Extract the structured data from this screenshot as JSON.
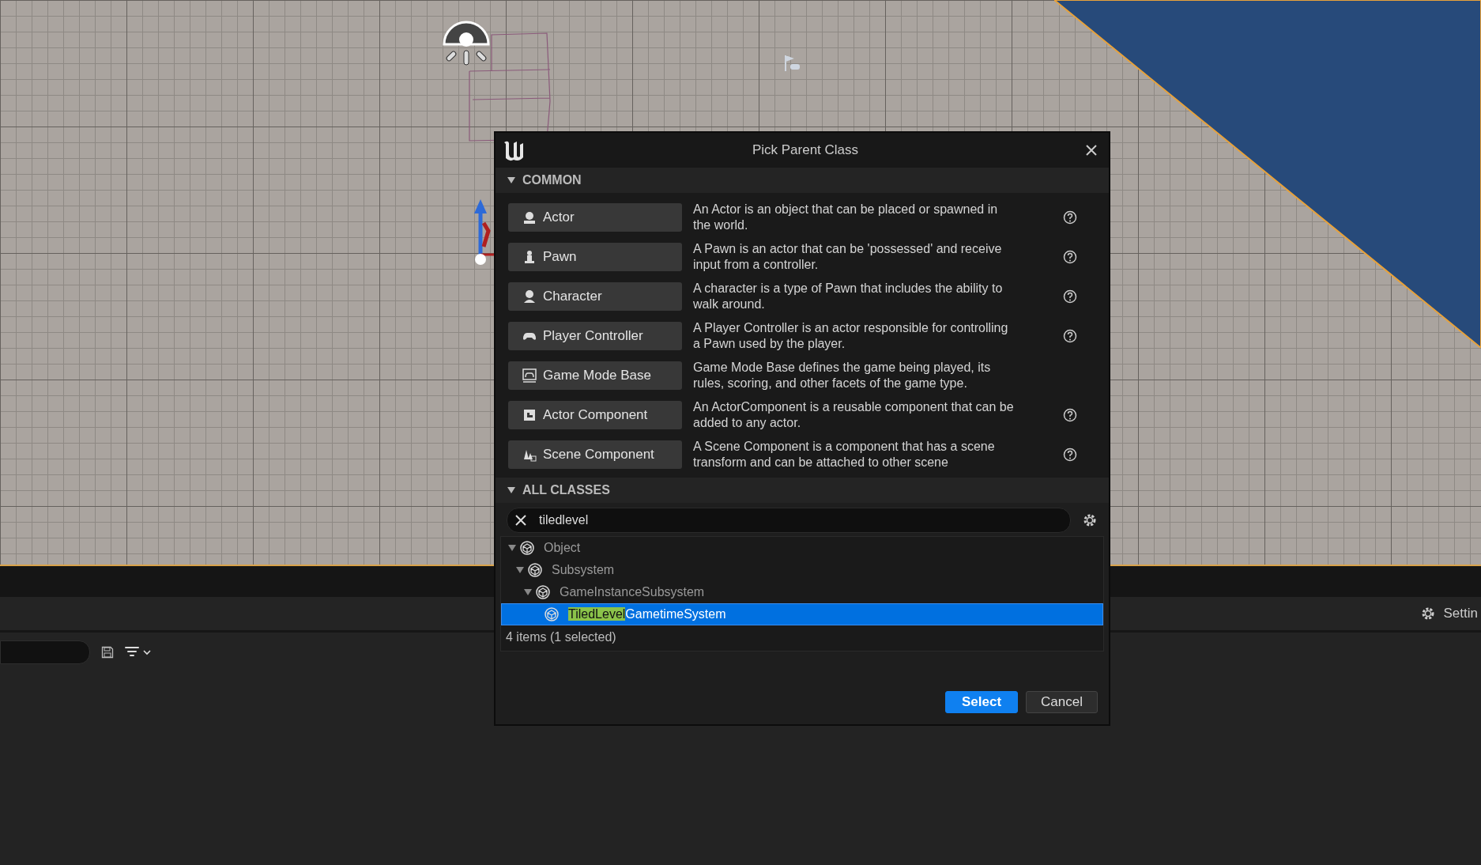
{
  "dialog": {
    "title": "Pick Parent Class",
    "common": {
      "label": "COMMON",
      "expanded": true,
      "items": [
        {
          "kind": "actor",
          "label": "Actor",
          "description": [
            "An Actor is an object that can be placed or spawned in",
            "the world."
          ],
          "help": true
        },
        {
          "kind": "pawn",
          "label": "Pawn",
          "description": [
            "A Pawn is an actor that can be 'possessed' and receive",
            "input from a controller."
          ],
          "help": true
        },
        {
          "kind": "character",
          "label": "Character",
          "description": [
            "A character is a type of Pawn that includes the ability to",
            "walk around."
          ],
          "help": true
        },
        {
          "kind": "controller",
          "label": "Player Controller",
          "description": [
            "A Player Controller is an actor responsible for controlling",
            "a Pawn used by the player."
          ],
          "help": true
        },
        {
          "kind": "gamemode",
          "label": "Game Mode Base",
          "description": [
            "Game Mode Base defines the game being played, its",
            "rules, scoring, and other facets of the game type."
          ],
          "help": false
        },
        {
          "kind": "component",
          "label": "Actor Component",
          "description": [
            "An ActorComponent is a reusable component that can be",
            "added to any actor."
          ],
          "help": true
        },
        {
          "kind": "scene",
          "label": "Scene Component",
          "description": [
            "A Scene Component is a component that has a scene",
            "transform and can be attached to other scene"
          ],
          "help": true
        }
      ]
    },
    "all_classes": {
      "label": "ALL CLASSES",
      "expanded": true,
      "search": {
        "value": "tiledlevel"
      },
      "tree": [
        {
          "name": {
            "rest": "Object"
          },
          "expanded": true,
          "selected": false,
          "children": [
            {
              "name": {
                "rest": "Subsystem"
              },
              "expanded": true,
              "selected": false,
              "children": [
                {
                  "name": {
                    "rest": "GameInstanceSubsystem"
                  },
                  "expanded": true,
                  "selected": false,
                  "children": [
                    {
                      "name": {
                        "match": "TiledLevel",
                        "rest": "GametimeSystem"
                      },
                      "expanded": false,
                      "selected": true
                    }
                  ]
                }
              ]
            }
          ]
        }
      ],
      "status": "4 items (1 selected)"
    },
    "buttons": [
      {
        "label": "Select",
        "primary": true
      },
      {
        "label": "Cancel",
        "primary": false
      }
    ]
  },
  "bottom_panel": {
    "settings_label": "Settin"
  }
}
